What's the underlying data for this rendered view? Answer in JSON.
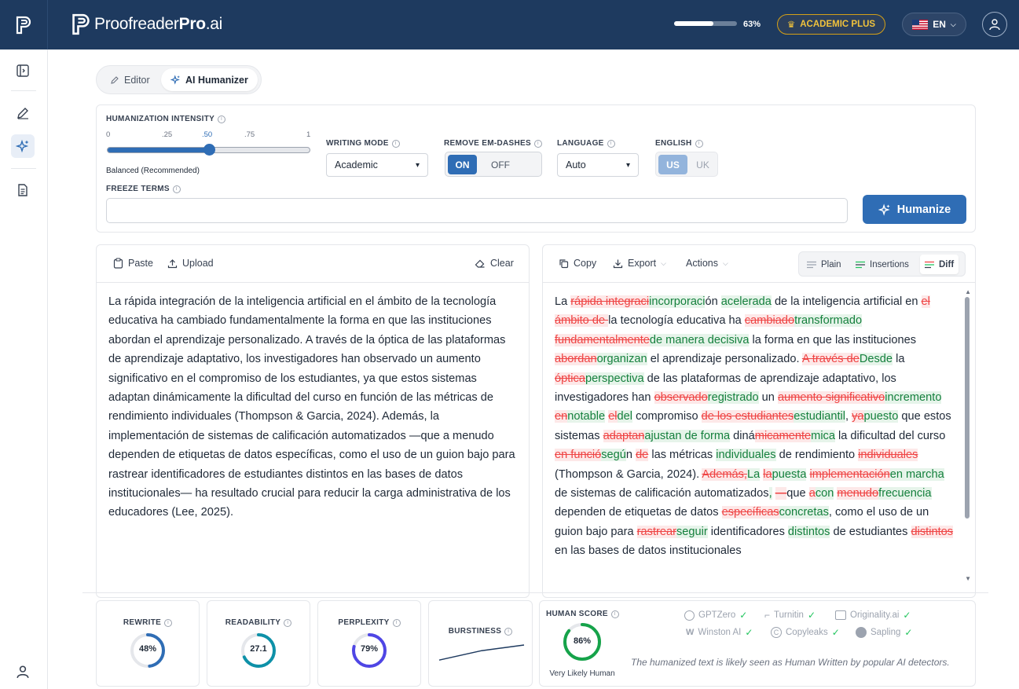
{
  "app": {
    "brand_prefix": "Proofreader",
    "brand_bold": "Pro",
    "brand_suffix": ".ai",
    "usage_percent": 63,
    "usage_label": "63%",
    "plan_label": "ACADEMIC PLUS",
    "language_code": "EN"
  },
  "mode_tabs": [
    {
      "label": "Editor",
      "active": false
    },
    {
      "label": "AI Humanizer",
      "active": true
    }
  ],
  "settings": {
    "intensity_label": "HUMANIZATION INTENSITY",
    "intensity_ticks": [
      "0",
      ".25",
      ".50",
      ".75",
      "1"
    ],
    "intensity_value": 0.5,
    "intensity_caption": "Balanced (Recommended)",
    "writing_mode_label": "WRITING MODE",
    "writing_mode_value": "Academic",
    "em_dash_label": "REMOVE EM-DASHES",
    "em_dash_on": "ON",
    "em_dash_off": "OFF",
    "language_label": "LANGUAGE",
    "language_value": "Auto",
    "english_label": "ENGLISH",
    "english_us": "US",
    "english_uk": "UK",
    "freeze_label": "FREEZE TERMS",
    "freeze_value": "",
    "humanize_label": "Humanize"
  },
  "input_panel": {
    "paste_label": "Paste",
    "upload_label": "Upload",
    "clear_label": "Clear",
    "text": "La rápida integración de la inteligencia artificial en el ámbito de la tecnología educativa ha cambiado fundamentalmente la forma en que las instituciones abordan el aprendizaje personalizado. A través de la óptica de las plataformas de aprendizaje adaptativo, los investigadores han observado un aumento significativo en el compromiso de los estudiantes, ya que estos sistemas adaptan dinámicamente la dificultad del curso en función de las métricas de rendimiento individuales (Thompson & Garcia, 2024). Además, la implementación de sistemas de calificación automatizados —que a menudo dependen de etiquetas de datos específicas, como el uso de un guion bajo para rastrear identificadores de estudiantes distintos en las bases de datos institucionales— ha resultado crucial para reducir la carga administrativa de los educadores (Lee, 2025)."
  },
  "output_panel": {
    "copy_label": "Copy",
    "export_label": "Export",
    "actions_label": "Actions",
    "views": [
      {
        "label": "Plain",
        "active": false
      },
      {
        "label": "Insertions",
        "active": false
      },
      {
        "label": "Diff",
        "active": true
      }
    ],
    "diff_segments": [
      {
        "t": "La "
      },
      {
        "d": "rápida integraci"
      },
      {
        "i": "incorporaci"
      },
      {
        "t": "ón "
      },
      {
        "i": "acelerada"
      },
      {
        "t": " de la inteligencia artificial en "
      },
      {
        "d": "el ámbito de "
      },
      {
        "t": "la tecnología educativa ha "
      },
      {
        "d": "cambiado"
      },
      {
        "i": "transformado"
      },
      {
        "t": " "
      },
      {
        "d": "fundamentalmente"
      },
      {
        "i": "de manera decisiva"
      },
      {
        "t": " la forma en que las instituciones "
      },
      {
        "d": "abordan"
      },
      {
        "i": "organizan"
      },
      {
        "t": " el aprendizaje personalizado. "
      },
      {
        "d": "A través de"
      },
      {
        "i": "Desde"
      },
      {
        "t": " la "
      },
      {
        "d": "óptica"
      },
      {
        "i": "perspectiva"
      },
      {
        "t": " de las plataformas de aprendizaje adaptativo, los investigadores han "
      },
      {
        "d": "observado"
      },
      {
        "i": "registrado"
      },
      {
        "t": " un "
      },
      {
        "d": "aumento significativo"
      },
      {
        "i": "incremento"
      },
      {
        "t": " "
      },
      {
        "d": "en"
      },
      {
        "i": "notable"
      },
      {
        "t": " "
      },
      {
        "d": "el"
      },
      {
        "i": "del"
      },
      {
        "t": " compromiso "
      },
      {
        "d": "de los estudiantes"
      },
      {
        "i": "estudiantil"
      },
      {
        "t": ", "
      },
      {
        "d": "ya"
      },
      {
        "i": "puesto"
      },
      {
        "t": " que estos sistemas "
      },
      {
        "d": "adaptan"
      },
      {
        "i": "ajustan de forma"
      },
      {
        "t": " diná"
      },
      {
        "d": "micamente"
      },
      {
        "i": "mica"
      },
      {
        "t": " la dificultad del curso "
      },
      {
        "d": "en funció"
      },
      {
        "i": "segú"
      },
      {
        "t": "n "
      },
      {
        "d": "de"
      },
      {
        "t": " las métricas "
      },
      {
        "i": "individuales"
      },
      {
        "t": " de rendimiento "
      },
      {
        "d": "individuales"
      },
      {
        "t": " (Thompson & Garcia, 2024). "
      },
      {
        "d": "Además,"
      },
      {
        "i": "La"
      },
      {
        "t": " "
      },
      {
        "d": "la"
      },
      {
        "i": "puesta"
      },
      {
        "t": " "
      },
      {
        "d": "implementación"
      },
      {
        "i": "en marcha"
      },
      {
        "t": " de sistemas de calificación automatizados"
      },
      {
        "i": ","
      },
      {
        "t": " "
      },
      {
        "d": "—"
      },
      {
        "t": "que "
      },
      {
        "d": "a"
      },
      {
        "i": "con"
      },
      {
        "t": " "
      },
      {
        "d": "menudo"
      },
      {
        "i": "frecuencia"
      },
      {
        "t": " dependen de etiquetas de datos "
      },
      {
        "d": "específicas"
      },
      {
        "i": "concretas"
      },
      {
        "t": ", como el uso de un guion bajo para "
      },
      {
        "d": "rastrear"
      },
      {
        "i": "seguir"
      },
      {
        "t": " identificadores "
      },
      {
        "i": "distintos"
      },
      {
        "t": " de estudiantes "
      },
      {
        "d": "distintos"
      },
      {
        "t": " en las bases de datos institucionales"
      }
    ]
  },
  "metrics": [
    {
      "label": "REWRITE",
      "value": 48,
      "display": "48%",
      "color": "#2f6db5"
    },
    {
      "label": "READABILITY",
      "value": 68,
      "display": "27.1",
      "color": "#0e91a8"
    },
    {
      "label": "PERPLEXITY",
      "value": 79,
      "display": "79%",
      "color": "#4f46e5"
    }
  ],
  "burstiness": {
    "label": "BURSTINESS",
    "points": [
      [
        0,
        0.2
      ],
      [
        1,
        0.45
      ],
      [
        2,
        0.7
      ],
      [
        3,
        0.85
      ],
      [
        4,
        1.0
      ]
    ]
  },
  "human_score": {
    "label": "HUMAN SCORE",
    "value": 86,
    "display": "86%",
    "caption": "Very Likely Human",
    "color": "#16a34a",
    "detectors": [
      {
        "name": "GPTZero",
        "icon": "gptzero-icon"
      },
      {
        "name": "Turnitin",
        "icon": "turnitin-icon"
      },
      {
        "name": "Originality.ai",
        "icon": "originality-icon"
      },
      {
        "name": "Winston AI",
        "icon": "winston-icon"
      },
      {
        "name": "Copyleaks",
        "icon": "copyleaks-icon"
      },
      {
        "name": "Sapling",
        "icon": "sapling-icon"
      }
    ],
    "note": "The humanized text is likely seen as Human Written by popular AI detectors."
  }
}
